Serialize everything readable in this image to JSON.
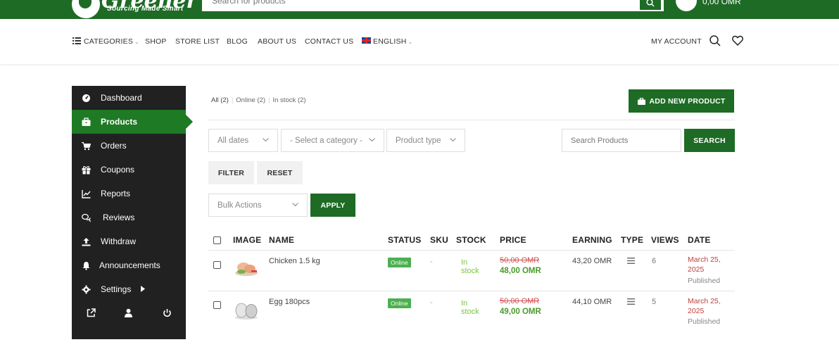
{
  "header": {
    "logo_word": "Greener",
    "logo_tagline": "Sourcing Made Smart",
    "search_placeholder": "Search for products",
    "cart_total": "0,00 OMR"
  },
  "nav": {
    "categories": "CATEGORIES",
    "shop": "SHOP",
    "store_list": "STORE LIST",
    "blog": "BLOG",
    "about": "ABOUT US",
    "contact": "CONTACT US",
    "language": "ENGLISH",
    "account": "MY ACCOUNT"
  },
  "sidebar": {
    "items": [
      {
        "label": "Dashboard",
        "icon": "dashboard-icon"
      },
      {
        "label": "Products",
        "icon": "briefcase-icon",
        "active": true
      },
      {
        "label": "Orders",
        "icon": "cart-icon"
      },
      {
        "label": "Coupons",
        "icon": "gift-icon"
      },
      {
        "label": "Reports",
        "icon": "chart-icon"
      },
      {
        "label": "Reviews",
        "icon": "comments-icon"
      },
      {
        "label": "Withdraw",
        "icon": "upload-icon"
      },
      {
        "label": "Announcements",
        "icon": "bell-icon"
      },
      {
        "label": "Settings",
        "icon": "gear-icon"
      }
    ]
  },
  "filters": {
    "all": "All",
    "all_count": "(2)",
    "online": "Online",
    "online_count": "(2)",
    "instock": "In stock",
    "instock_count": "(2)"
  },
  "toolbar": {
    "add_new": "ADD NEW PRODUCT",
    "dates": "All dates",
    "category": "- Select a category -",
    "product_type": "Product type",
    "search_placeholder": "Search Products",
    "search": "SEARCH",
    "filter": "FILTER",
    "reset": "RESET",
    "bulk": "Bulk Actions",
    "apply": "APPLY"
  },
  "table": {
    "headers": {
      "image": "IMAGE",
      "name": "NAME",
      "status": "STATUS",
      "sku": "SKU",
      "stock": "STOCK",
      "price": "PRICE",
      "earning": "EARNING",
      "type": "TYPE",
      "views": "VIEWS",
      "date": "DATE"
    },
    "rows": [
      {
        "name": "Chicken 1.5 kg",
        "status": "Online",
        "sku": "-",
        "stock_1": "In",
        "stock_2": "stock",
        "price_old": "50,00 OMR",
        "price_new": "48,00 OMR",
        "earning": "43,20 OMR",
        "views": "6",
        "date_1": "March 25,",
        "date_2": "2025",
        "state": "Published"
      },
      {
        "name": "Egg 180pcs",
        "status": "Online",
        "sku": "-",
        "stock_1": "In",
        "stock_2": "stock",
        "price_old": "50,00 OMR",
        "price_new": "49,00 OMR",
        "earning": "44,10 OMR",
        "views": "5",
        "date_1": "March 25,",
        "date_2": "2025",
        "state": "Published"
      }
    ]
  }
}
